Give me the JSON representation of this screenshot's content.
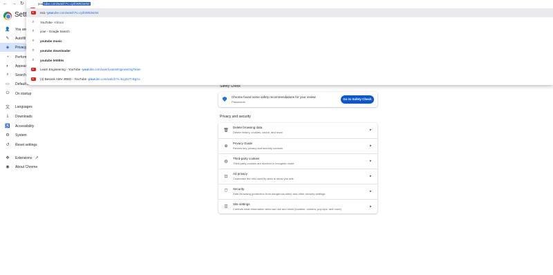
{
  "toolbar": {
    "back_icon": "back-arrow-icon",
    "forward_icon": "forward-arrow-icon",
    "reload_icon": "reload-icon",
    "omnibox": {
      "typed": "you",
      "completion": "tube.com/watch?v=cpfoW52wr54"
    }
  },
  "suggestions": [
    {
      "icon": "youtube-icon",
      "prefix": "no1 - ",
      "bold": "you",
      "rest": "tube.com/watch?v=cpfoW52wr54",
      "highlighted": true
    },
    {
      "icon": "search-icon",
      "bold": "YouTube",
      "rest": " - Kllitaar"
    },
    {
      "icon": "search-icon",
      "rest": "your - Google Search"
    },
    {
      "icon": "search-icon",
      "bold": "youtube music"
    },
    {
      "icon": "search-icon",
      "bold": "youtube downloader"
    },
    {
      "icon": "search-icon",
      "bold": "youtube letöltés"
    },
    {
      "icon": "youtube-icon",
      "prefix": "Learn Engineering - YouTube - ",
      "bold": "you",
      "rest": "tube.com/user/LearnEngineeringTeam"
    },
    {
      "icon": "youtube-icon",
      "prefix": "(4) Besenk AMV JRED - YouTube - ",
      "bold": "you",
      "rest": "tube.com/watch?v=kcgG2T-BgGc"
    }
  ],
  "sidebar": {
    "title": "Settings",
    "items": [
      {
        "label": "You and",
        "icon": "person-icon"
      },
      {
        "label": "Autofill",
        "icon": "autofill-icon"
      },
      {
        "label": "Privacy",
        "icon": "shield-icon",
        "active": true
      },
      {
        "label": "Perform",
        "icon": "speedometer-icon"
      },
      {
        "label": "Appear",
        "icon": "palette-icon"
      },
      {
        "label": "Search e",
        "icon": "search-icon"
      },
      {
        "label": "Default browser",
        "icon": "browser-icon"
      },
      {
        "label": "On startup",
        "icon": "power-icon"
      },
      {
        "label": "Languages",
        "icon": "translate-icon"
      },
      {
        "label": "Downloads",
        "icon": "download-icon"
      },
      {
        "label": "Accessibility",
        "icon": "accessibility-icon"
      },
      {
        "label": "System",
        "icon": "wrench-icon"
      },
      {
        "label": "Reset settings",
        "icon": "reset-icon"
      },
      {
        "label": "Extensions",
        "icon": "puzzle-icon"
      },
      {
        "label": "About Chrome",
        "icon": "chrome-icon"
      }
    ]
  },
  "safety_check": {
    "label": "Safety Check",
    "title": "Chrome found some safety recommendations for your review",
    "subtitle": "Passwords",
    "button": "Go to Safety Check"
  },
  "privacy": {
    "label": "Privacy and security",
    "rows": [
      {
        "title": "Delete browsing data",
        "subtitle": "Delete history, cookies, cache, and more",
        "icon": "trash-icon"
      },
      {
        "title": "Privacy Guide",
        "subtitle": "Review key privacy and security controls",
        "icon": "privacy-guide-icon"
      },
      {
        "title": "Third-party cookies",
        "subtitle": "Third-party cookies are blocked in Incognito mode",
        "icon": "cookie-icon"
      },
      {
        "title": "Ad privacy",
        "subtitle": "Customize the info used by sites to show you ads",
        "icon": "ad-privacy-icon"
      },
      {
        "title": "Security",
        "subtitle": "Safe Browsing (protection from dangerous sites) and other security settings",
        "icon": "security-shield-icon"
      },
      {
        "title": "Site settings",
        "subtitle": "Controls what information sites can use and show (location, camera, pop-ups, and more)",
        "icon": "sliders-icon"
      }
    ]
  }
}
